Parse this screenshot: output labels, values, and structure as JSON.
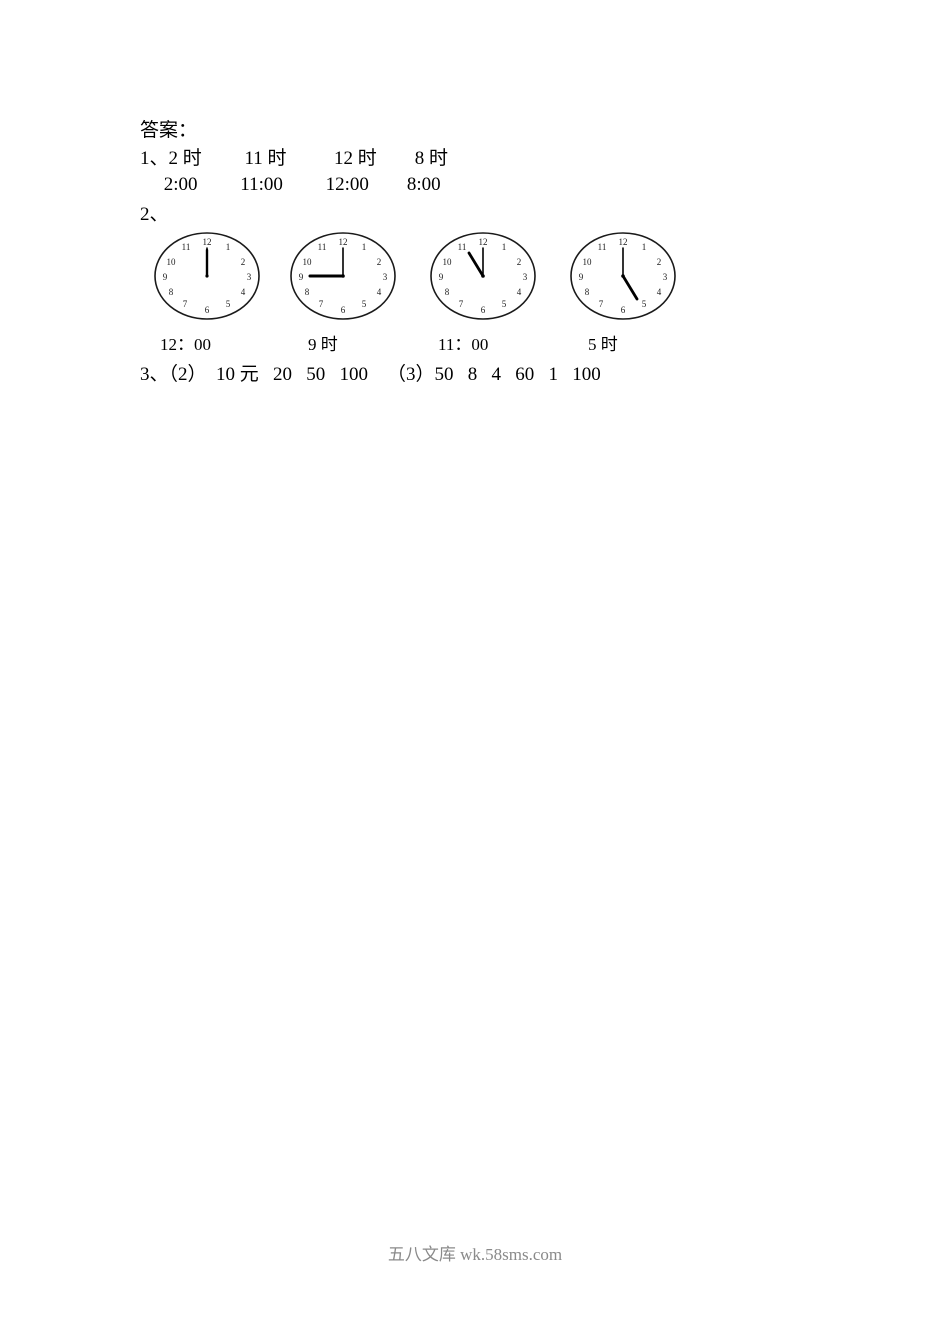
{
  "document": {
    "answer_title": "答案：",
    "q1": {
      "line1": "1、2 时         11 时          12 时        8 时",
      "line2": "     2:00         11:00         12:00        8:00"
    },
    "q2": {
      "label": "2、",
      "clocks": [
        {
          "time_label": "12：00",
          "hour": 12,
          "minute": 0
        },
        {
          "time_label": "9 时",
          "hour": 9,
          "minute": 0
        },
        {
          "time_label": "11：00",
          "hour": 11,
          "minute": 0
        },
        {
          "time_label": "5 时",
          "hour": 5,
          "minute": 0
        }
      ],
      "numerals": [
        "12",
        "1",
        "2",
        "3",
        "4",
        "5",
        "6",
        "7",
        "8",
        "9",
        "10",
        "11"
      ]
    },
    "q3": {
      "line": "3、（2）  10 元   20   50   100    （3）50   8   4   60   1   100"
    }
  },
  "watermark": {
    "text": "五八文库 wk.58sms.com"
  },
  "colors": {
    "text": "#000000",
    "watermark": "#8a8a8a",
    "clock_stroke": "#1a1a1a",
    "page_background": "#ffffff"
  }
}
